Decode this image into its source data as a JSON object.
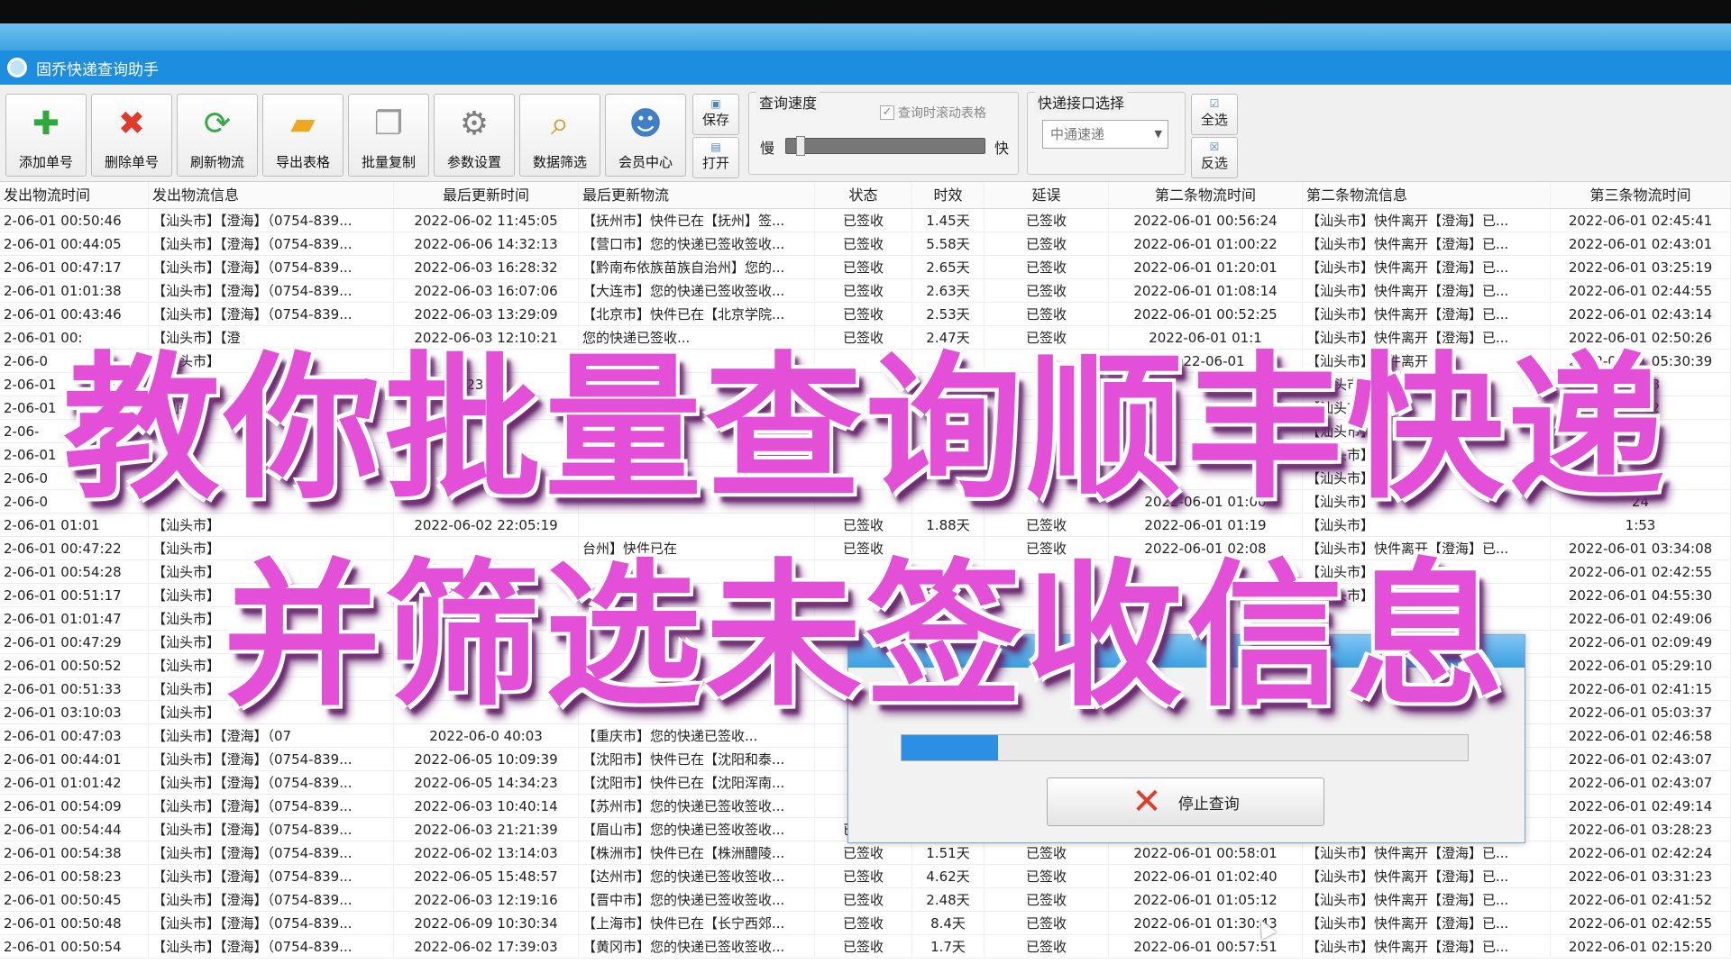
{
  "app": {
    "title": "固乔快递查询助手"
  },
  "toolbar": {
    "buttons": [
      {
        "label": "添加单号",
        "icon": "✚",
        "color": "#2fa83a"
      },
      {
        "label": "删除单号",
        "icon": "✖",
        "color": "#e03a2b"
      },
      {
        "label": "刷新物流",
        "icon": "⟳",
        "color": "#38a84a"
      },
      {
        "label": "导出表格",
        "icon": "📂",
        "color": "#f0a720"
      },
      {
        "label": "批量复制",
        "icon": "📄",
        "color": "#9a9a9a"
      },
      {
        "label": "参数设置",
        "icon": "⚙",
        "color": "#7d7d7d"
      },
      {
        "label": "数据筛选",
        "icon": "🔍",
        "color": "#d59a28"
      },
      {
        "label": "会员中心",
        "icon": "👥",
        "color": "#3f7fc7"
      }
    ],
    "save_label": "保存",
    "open_label": "打开",
    "speed": {
      "title": "查询速度",
      "slow": "慢",
      "fast": "快",
      "autoscroll_label": "查询时滚动表格",
      "autoscroll_checked": true,
      "level": 0.05
    },
    "interface": {
      "title": "快递接口选择",
      "selected": "中通速递"
    },
    "select_all_label": "全选",
    "invert_label": "反选"
  },
  "table": {
    "columns": [
      "发出物流时间",
      "发出物流信息",
      "最后更新时间",
      "最后更新物流",
      "状态",
      "时效",
      "延误",
      "第二条物流时间",
      "第二条物流信息",
      "第三条物流时间"
    ],
    "rows": [
      [
        "2-06-01 00:50:46",
        "【汕头市】【澄海】（0754-839...",
        "2022-06-02 11:45:05",
        "【抚州市】快件已在【抚州】签...",
        "已签收",
        "1.45天",
        "已签收",
        "2022-06-01 00:56:24",
        "【汕头市】快件离开【澄海】已...",
        "2022-06-01 02:45:41"
      ],
      [
        "2-06-01 00:44:05",
        "【汕头市】【澄海】（0754-839...",
        "2022-06-06 14:32:13",
        "【营口市】您的快递已签收签收...",
        "已签收",
        "5.58天",
        "已签收",
        "2022-06-01 01:00:22",
        "【汕头市】快件离开【澄海】已...",
        "2022-06-01 02:43:01"
      ],
      [
        "2-06-01 00:47:17",
        "【汕头市】【澄海】（0754-839...",
        "2022-06-03 16:28:32",
        "【黔南布依族苗族自治州】您的...",
        "已签收",
        "2.65天",
        "已签收",
        "2022-06-01 01:20:01",
        "【汕头市】快件离开【澄海】已...",
        "2022-06-01 03:25:19"
      ],
      [
        "2-06-01 01:01:38",
        "【汕头市】【澄海】（0754-839...",
        "2022-06-03 16:07:06",
        "【大连市】您的快递已签收签收...",
        "已签收",
        "2.63天",
        "已签收",
        "2022-06-01 01:08:14",
        "【汕头市】快件离开【澄海】已...",
        "2022-06-01 02:44:55"
      ],
      [
        "2-06-01 00:43:46",
        "【汕头市】【澄海】（0754-839...",
        "2022-06-03 13:29:09",
        "【北京市】快件已在【北京学院...",
        "已签收",
        "2.53天",
        "已签收",
        "2022-06-01 00:52:25",
        "【汕头市】快件离开【澄海】已...",
        "2022-06-01 02:43:14"
      ],
      [
        "2-06-01 00:",
        "【汕头市】【澄",
        "2022-06-03 12:10:21",
        "您的快递已签收...",
        "已签收",
        "2.47天",
        "已签收",
        "2022-06-01 01:1",
        "【汕头市】快件离开【澄海】已...",
        "2022-06-01 02:50:26"
      ],
      [
        "2-06-0",
        "【汕头市】",
        "",
        "您的快递...",
        "",
        "",
        "",
        "2022-06-01",
        "【汕头市】快件离开",
        "2022-06-01 05:30:39"
      ],
      [
        "2-06-01",
        "【汕头市】",
        "23:23",
        "件已在【",
        "",
        "",
        "",
        "",
        "【汕头市】",
        "10:58"
      ],
      [
        "2-06-01",
        "【汕头",
        "",
        "快件已在",
        "",
        "",
        "",
        "",
        "【汕头市】",
        "37:52"
      ],
      [
        "2-06-",
        "【汕头",
        "",
        "已在【",
        "",
        "",
        "",
        "",
        "【汕头市】",
        "44"
      ],
      [
        "2-06-01",
        "",
        "",
        "件已在【",
        "",
        "",
        "",
        "",
        "【汕头市】",
        "21"
      ],
      [
        "2-06-0",
        "",
        "",
        "快递已签",
        "",
        "",
        "",
        "",
        "【汕头市】",
        "1:02"
      ],
      [
        "2-06-0",
        "",
        "",
        "",
        "",
        "",
        "",
        "2022-06-01 01:00",
        "【汕头市】",
        "24"
      ],
      [
        "2-06-01 01:01",
        "【汕头市】",
        "2022-06-02 22:05:19",
        "",
        "已签收",
        "1.88天",
        "已签收",
        "2022-06-01 01:19",
        "【汕头市】",
        "1:53"
      ],
      [
        "2-06-01 00:47:22",
        "【汕头市】",
        "",
        "台州】快件已在",
        "已签收",
        "",
        "已签收",
        "2022-06-01 02:08",
        "【汕头市】快件离开【澄海】已...",
        "2022-06-01 03:34:08"
      ],
      [
        "2-06-01 00:54:28",
        "【汕头市】",
        "",
        "",
        "",
        "",
        "",
        "",
        "【汕头市】",
        "2022-06-01 02:42:55"
      ],
      [
        "2-06-01 00:51:17",
        "【汕头市】",
        "",
        "快递已签收",
        "",
        "",
        "",
        "",
        "【汕头市】",
        "2022-06-01 04:55:30"
      ],
      [
        "2-06-01 01:01:47",
        "【汕头市】",
        "",
        "",
        "",
        "",
        "",
        "",
        "",
        "2022-06-01 02:49:06"
      ],
      [
        "2-06-01 00:47:29",
        "【汕头市】",
        "",
        "",
        "",
        "",
        "",
        "",
        "",
        "2022-06-01 02:09:49"
      ],
      [
        "2-06-01 00:50:52",
        "【汕头市】",
        "",
        "",
        "",
        "",
        "",
        "",
        "",
        "2022-06-01 05:29:10"
      ],
      [
        "2-06-01 00:51:33",
        "【汕头市】",
        "",
        "",
        "",
        "",
        "",
        "",
        "",
        "2022-06-01 02:41:15"
      ],
      [
        "2-06-01 03:10:03",
        "【汕头市】",
        "",
        "",
        "",
        "",
        "",
        "",
        "",
        "2022-06-01 05:03:37"
      ],
      [
        "2-06-01 00:47:03",
        "【汕头市】【澄海】（07",
        "2022-06-0  40:03",
        "【重庆市】您的快递已签收...",
        "",
        "",
        "",
        "",
        "",
        "2022-06-01 02:46:58"
      ],
      [
        "2-06-01 00:44:01",
        "【汕头市】【澄海】（0754-839...",
        "2022-06-05 10:09:39",
        "【沈阳市】快件已在【沈阳和泰...",
        "",
        "",
        "",
        "",
        "",
        "2022-06-01 02:43:07"
      ],
      [
        "2-06-01 01:01:42",
        "【汕头市】【澄海】（0754-839...",
        "2022-06-05 14:34:23",
        "【沈阳市】快件已在【沈阳浑南...",
        "",
        "",
        "",
        "",
        "",
        "2022-06-01 02:43:07"
      ],
      [
        "2-06-01 00:54:09",
        "【汕头市】【澄海】（0754-839...",
        "2022-06-03 10:40:14",
        "【苏州市】您的快递已签收签收...",
        "",
        "",
        "",
        "",
        "",
        "2022-06-01 02:49:14"
      ],
      [
        "2-06-01 00:54:44",
        "【汕头市】【澄海】（0754-839...",
        "2022-06-03 21:21:39",
        "【眉山市】您的快递已签收签收...",
        "已签收",
        "2.85天",
        "已签收",
        "2022-06-01 01:29:35",
        "【汕头市】快件离开【澄海】已...",
        "2022-06-01 03:28:23"
      ],
      [
        "2-06-01 00:54:38",
        "【汕头市】【澄海】（0754-839...",
        "2022-06-02 13:14:03",
        "【株洲市】快件已在【株洲醴陵...",
        "已签收",
        "1.51天",
        "已签收",
        "2022-06-01 00:58:01",
        "【汕头市】快件离开【澄海】已...",
        "2022-06-01 02:42:24"
      ],
      [
        "2-06-01 00:58:23",
        "【汕头市】【澄海】（0754-839...",
        "2022-06-05 15:48:57",
        "【达州市】您的快递已签收签收...",
        "已签收",
        "4.62天",
        "已签收",
        "2022-06-01 01:02:40",
        "【汕头市】快件离开【澄海】已...",
        "2022-06-01 03:31:23"
      ],
      [
        "2-06-01 00:50:45",
        "【汕头市】【澄海】（0754-839...",
        "2022-06-03 12:19:16",
        "【晋中市】您的快递已签收签收...",
        "已签收",
        "2.48天",
        "已签收",
        "2022-06-01 01:05:12",
        "【汕头市】快件离开【澄海】已...",
        "2022-06-01 02:41:52"
      ],
      [
        "2-06-01 00:50:48",
        "【汕头市】【澄海】（0754-839...",
        "2022-06-09 10:30:34",
        "【上海市】快件已在【长宁西郊...",
        "已签收",
        "8.4天",
        "已签收",
        "2022-06-01 01:30:43",
        "【汕头市】快件离开【澄海】已...",
        "2022-06-01 02:42:55"
      ],
      [
        "2-06-01 00:50:54",
        "【汕头市】【澄海】（0754-839...",
        "2022-06-02 17:39:03",
        "【黄冈市】您的快递已签收签收...",
        "已签收",
        "1.7天",
        "已签收",
        "2022-06-01 00:57:51",
        "【汕头市】快件离开【澄海】已...",
        "2022-06-01 02:15:20"
      ]
    ]
  },
  "dialog": {
    "progress": 0.17,
    "stop_label": "停止查询"
  },
  "overlay": {
    "line1": "教你批量查询顺丰快递",
    "line2": "并筛选未签收信息",
    "color": "#e44fd7"
  }
}
